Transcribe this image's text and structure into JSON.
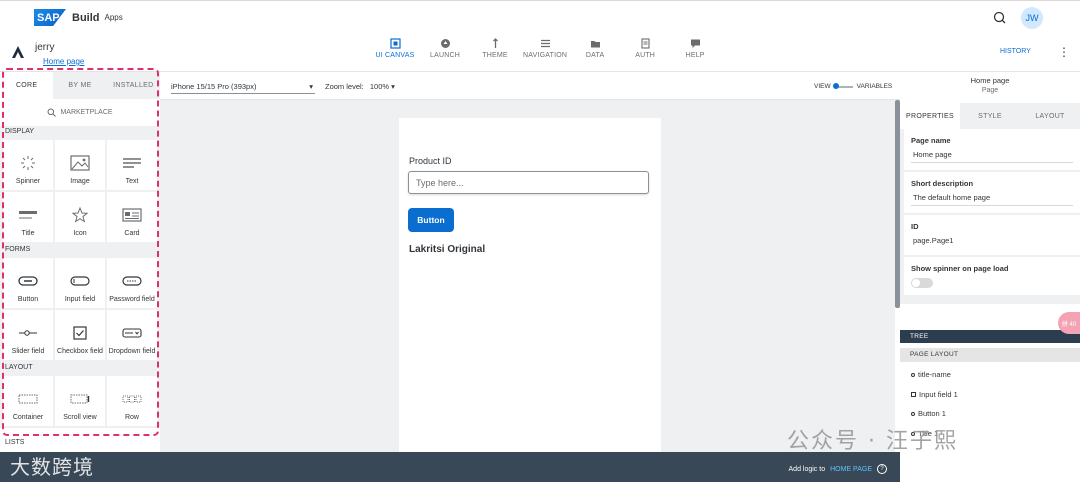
{
  "topbar": {
    "logo": "SAP",
    "app_name": "Build",
    "app_sub": "Apps",
    "avatar": "JW"
  },
  "project": {
    "name": "jerry",
    "page_link": "Home page"
  },
  "nav": [
    {
      "label": "UI CANVAS",
      "icon": "ui-canvas-icon"
    },
    {
      "label": "LAUNCH",
      "icon": "launch-icon"
    },
    {
      "label": "THEME",
      "icon": "theme-icon"
    },
    {
      "label": "NAVIGATION",
      "icon": "navigation-icon"
    },
    {
      "label": "DATA",
      "icon": "data-icon"
    },
    {
      "label": "AUTH",
      "icon": "auth-icon"
    },
    {
      "label": "HELP",
      "icon": "help-icon"
    }
  ],
  "history": "HISTORY",
  "palette": {
    "tabs": [
      "CORE",
      "BY ME",
      "INSTALLED"
    ],
    "marketplace": "MARKETPLACE",
    "sections": {
      "display": "DISPLAY",
      "forms": "FORMS",
      "layout": "LAYOUT",
      "lists": "LISTS"
    },
    "display_items": [
      "Spinner",
      "Image",
      "Text",
      "Title",
      "Icon",
      "Card"
    ],
    "forms_items": [
      "Button",
      "Input field",
      "Password field",
      "Slider field",
      "Checkbox field",
      "Dropdown field"
    ],
    "layout_items": [
      "Container",
      "Scroll view",
      "Row"
    ]
  },
  "canvasbar": {
    "device": "iPhone 15/15 Pro (393px)",
    "zoom_label": "Zoom level:",
    "zoom_value": "100%",
    "view": "VIEW",
    "variables": "VARIABLES"
  },
  "phone": {
    "label": "Product ID",
    "input_placeholder": "Type here...",
    "button": "Button",
    "text": "Lakritsi Original"
  },
  "rightpanel": {
    "title": "Home page",
    "subtitle": "Page",
    "tabs": [
      "PROPERTIES",
      "STYLE",
      "LAYOUT"
    ],
    "props": {
      "page_name_label": "Page name",
      "page_name_value": "Home page",
      "short_desc_label": "Short description",
      "short_desc_value": "The default home page",
      "id_label": "ID",
      "id_value": "page.Page1",
      "spinner_label": "Show spinner on page load"
    },
    "tree_head": "TREE",
    "layout_head": "PAGE LAYOUT",
    "tree_items": [
      "title-name",
      "Input field 1",
      "Button 1",
      "Title 1"
    ]
  },
  "bottombar": {
    "logic_text": "Add logic to",
    "logic_link": "HOME PAGE",
    "help": "?"
  },
  "watermarks": {
    "left": "大数跨境",
    "right": "公众号 · 汪子熙",
    "bubble": "拼 40"
  },
  "colors": {
    "accent": "#0a6ed1",
    "highlight_border": "#e0306b",
    "bottom_bar": "#384856"
  }
}
